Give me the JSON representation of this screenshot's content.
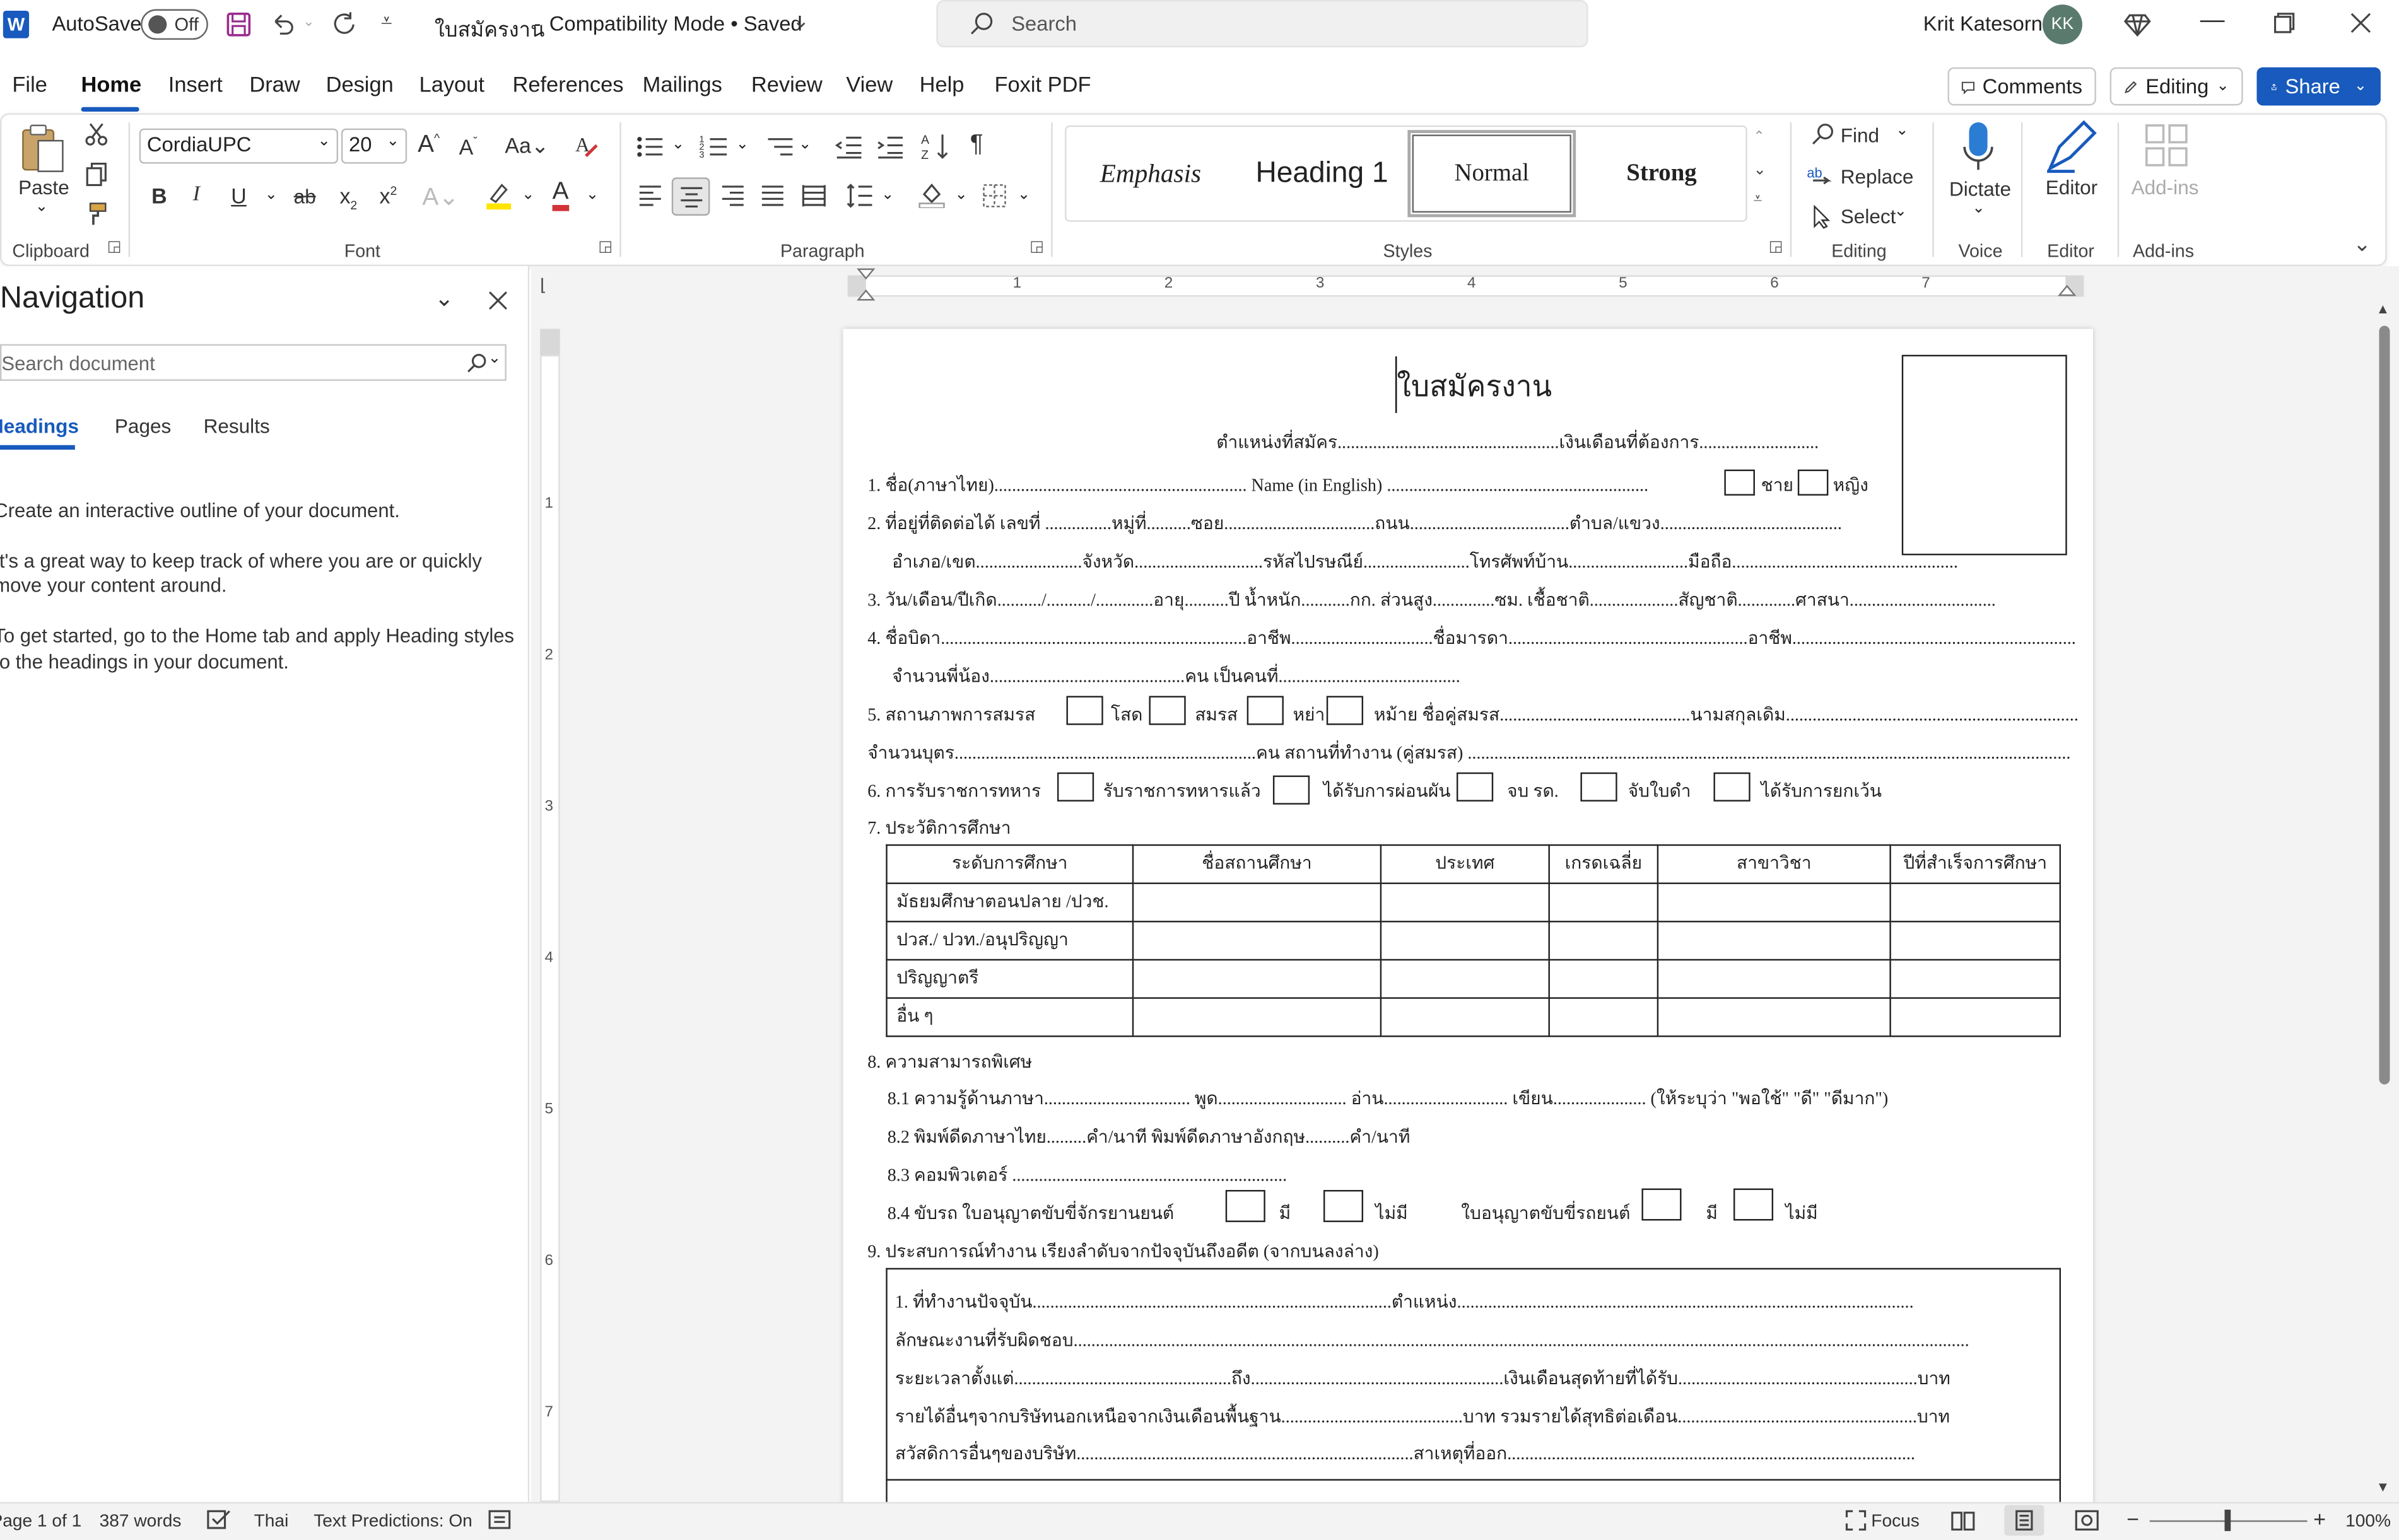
{
  "app": {
    "autosave_label": "AutoSave",
    "autosave_state": "Off",
    "doc_title": "ใบสมัครงาน",
    "doc_status": "Compatibility Mode • Saved",
    "user_name": "Krit Katesorn",
    "user_initials": "KK",
    "accent": "#185abd"
  },
  "search": {
    "placeholder": "Search"
  },
  "menu": {
    "tabs": [
      "File",
      "Home",
      "Insert",
      "Draw",
      "Design",
      "Layout",
      "References",
      "Mailings",
      "Review",
      "View",
      "Help",
      "Foxit PDF"
    ],
    "active": "Home",
    "comments_label": "Comments",
    "editing_label": "Editing",
    "share_label": "Share"
  },
  "ribbon": {
    "clipboard": {
      "paste_label": "Paste",
      "group_label": "Clipboard"
    },
    "font": {
      "font_name": "CordiaUPC",
      "font_size": "20",
      "group_label": "Font"
    },
    "paragraph": {
      "group_label": "Paragraph"
    },
    "styles": {
      "items": [
        "Emphasis",
        "Heading 1",
        "Normal",
        "Strong"
      ],
      "selected": "Normal",
      "group_label": "Styles"
    },
    "editing": {
      "find_label": "Find",
      "replace_label": "Replace",
      "select_label": "Select",
      "group_label": "Editing"
    },
    "voice": {
      "dictate_label": "Dictate",
      "group_label": "Voice"
    },
    "editor": {
      "label": "Editor",
      "group_label": "Editor"
    },
    "addins": {
      "label": "Add-ins",
      "group_label": "Add-ins"
    }
  },
  "nav": {
    "title": "Navigation",
    "search_placeholder": "Search document",
    "tabs": [
      "Headings",
      "Pages",
      "Results"
    ],
    "active_tab": "Headings",
    "msg1": "Create an interactive outline of your document.",
    "msg2a": "It's a great way to keep track of where you are or quickly",
    "msg2b": "move your content around.",
    "msg3a": "To get started, go to the Home tab and apply Heading styles",
    "msg3b": "to the headings in your document."
  },
  "ruler": {
    "h_ticks": [
      "1",
      "2",
      "3",
      "4",
      "5",
      "6",
      "7"
    ],
    "v_ticks": [
      "1",
      "2",
      "3",
      "4",
      "5",
      "6",
      "7"
    ]
  },
  "doc": {
    "title": "ใบสมัครงาน",
    "l_position": "ตำแหน่งที่สมัคร..................................................เงินเดือนที่ต้องการ...........................",
    "l1a": "1. ชื่อ(ภาษาไทย)......................................................... Name (in English) ...........................................................",
    "l1_male": "ชาย",
    "l1_female": "หญิง",
    "l2": "2. ที่อยู่ที่ติดต่อได้ เลขที่ ...............หมู่ที่..........ซอย..................................ถนน....................................ตำบล/แขวง.........................................",
    "l2b": "อำเภอ/เขต........................จังหวัด.............................รหัสไปรษณีย์........................โทรศัพท์บ้าน...........................มือถือ...................................................",
    "l3": "3. วัน/เดือน/ปีเกิด........../........../.............อายุ..........ปี น้ำหนัก...........กก. ส่วนสูง..............ซม. เชื้อชาติ....................สัญชาติ.............ศาสนา.................................",
    "l4": "4. ชื่อบิดา.....................................................................อาชีพ................................ชื่อมารดา......................................................อาชีพ................................................................",
    "l4b": "จำนวนพี่น้อง............................................คน เป็นคนที่.........................................",
    "l5_label": "5. สถานภาพการสมรส",
    "l5_single": "โสด",
    "l5_married": "สมรส",
    "l5_divorced": "หย่า",
    "l5_rest": "หม้าย ชื่อคู่สมรส...........................................นามสกุลเดิม..................................................................",
    "l5b": "จำนวนบุตร....................................................................คน    สถานที่ทำงาน (คู่สมรส) ........................................................................................................................................",
    "l6_label": "6. การรับราชการทหาร",
    "l6_opts": [
      "รับราชการทหารแล้ว",
      "ได้รับการผ่อนผัน",
      "จบ รด.",
      "จับใบดำ",
      "ได้รับการยกเว้น"
    ],
    "l7": "7. ประวัติการศึกษา",
    "edu_headers": [
      "ระดับการศึกษา",
      "ชื่อสถานศึกษา",
      "ประเทศ",
      "เกรดเฉลี่ย",
      "สาขาวิชา",
      "ปีที่สำเร็จการศึกษา"
    ],
    "edu_rows": [
      "มัธยมศึกษาตอนปลาย /ปวช.",
      "ปวส./ ปวท./อนุปริญญา",
      "ปริญญาตรี",
      "อื่น ๆ"
    ],
    "l8": "8. ความสามารถพิเศษ",
    "l81": "8.1 ความรู้ด้านภาษา.................................      พูด.............................    อ่าน............................    เขียน.....................  (ให้ระบุว่า \"พอใช้\" \"ดี\" \"ดีมาก\")",
    "l82": "8.2 พิมพ์ดีดภาษาไทย.........คำ/นาที พิมพ์ดีดภาษาอังกฤษ..........คำ/นาที",
    "l83": "8.3 คอมพิวเตอร์ ..............................................................",
    "l84_label": "8.4  ขับรถ    ใบอนุญาตขับขี่จักรยานยนต์",
    "l84_have": "มี",
    "l84_none": "ไม่มี",
    "l84_car": "ใบอนุญาตขับขี่รถยนต์",
    "l9": "9. ประสบการณ์ทำงาน เรียงลำดับจากปัจจุบันถึงอดีต (จากบนลงล่าง)",
    "w1": "1. ที่ทำงานปัจจุบัน.................................................................................ตำแหน่ง.......................................................................................................",
    "w2": "ลักษณะงานที่รับผิดชอบ..........................................................................................................................................................................................................",
    "w3": "ระยะเวลาตั้งแต่.................................................ถึง.........................................................เงินเดือนสุดท้ายที่ได้รับ......................................................บาท",
    "w4": "รายได้อื่นๆจากบริษัทนอกเหนือจากเงินเดือนพื้นฐาน.........................................บาท  รวมรายได้สุทธิต่อเดือน......................................................บาท",
    "w5": "สวัสดิการอื่นๆของบริษัท............................................................................สาเหตุที่ออก............................................................................................"
  },
  "status": {
    "page": "Page 1 of 1",
    "words": "387 words",
    "language": "Thai",
    "predictions": "Text Predictions: On",
    "focus": "Focus",
    "zoom": "100%"
  }
}
